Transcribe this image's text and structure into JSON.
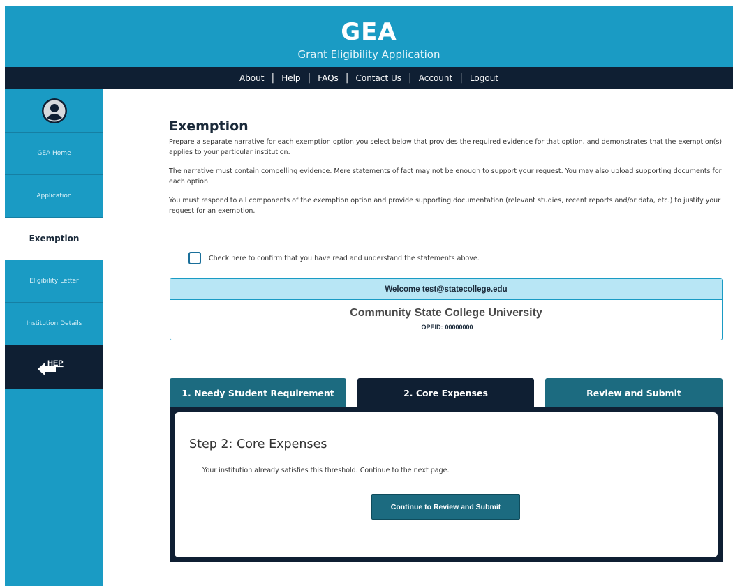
{
  "header": {
    "logo": "GEA",
    "subtitle": "Grant Eligibility Application"
  },
  "topnav": {
    "items": [
      "About",
      "Help",
      "FAQs",
      "Contact Us",
      "Account",
      "Logout"
    ],
    "separator": "|"
  },
  "sidebar": {
    "avatar_icon": "user-circle-icon",
    "items": [
      {
        "label": "GEA Home",
        "active": false
      },
      {
        "label": "Application",
        "active": false
      },
      {
        "label": "Exemption",
        "active": true
      },
      {
        "label": "Eligibility Letter",
        "active": false
      },
      {
        "label": "Institution Details",
        "active": false
      }
    ],
    "hep_label": "HEP",
    "hep_icon": "arrow-left-icon"
  },
  "main": {
    "title": "Exemption",
    "paragraphs": [
      "Prepare a separate narrative for each exemption option you select below that provides the required evidence for that option, and demonstrates that the exemption(s) applies to your particular institution.",
      "The narrative must contain compelling evidence. Mere statements of fact may not be enough to support your request. You may also upload supporting documents for each option.",
      "You must respond to all components of the exemption option and provide supporting documentation (relevant studies, recent reports and/or data, etc.) to justify your request for an exemption."
    ],
    "confirm_label": "Check here to confirm that you have read and understand the statements above."
  },
  "welcome": {
    "greeting": "Welcome test@statecollege.edu",
    "institution": "Community State College University",
    "opeid_label": "OPEID:",
    "opeid_value": "00000000"
  },
  "tabs": [
    {
      "label": "1. Needy Student Requirement",
      "active": false
    },
    {
      "label": "2. Core Expenses",
      "active": true
    },
    {
      "label": "Review and Submit",
      "active": false
    }
  ],
  "panel": {
    "step_title": "Step 2: Core Expenses",
    "message": "Your institution already satisfies this threshold. Continue to the next page.",
    "button_label": "Continue to Review and Submit"
  },
  "colors": {
    "brand_blue": "#1a9bc4",
    "navy": "#0f1f33",
    "teal": "#1c6b80",
    "welcome_bg": "#b8e6f5"
  }
}
